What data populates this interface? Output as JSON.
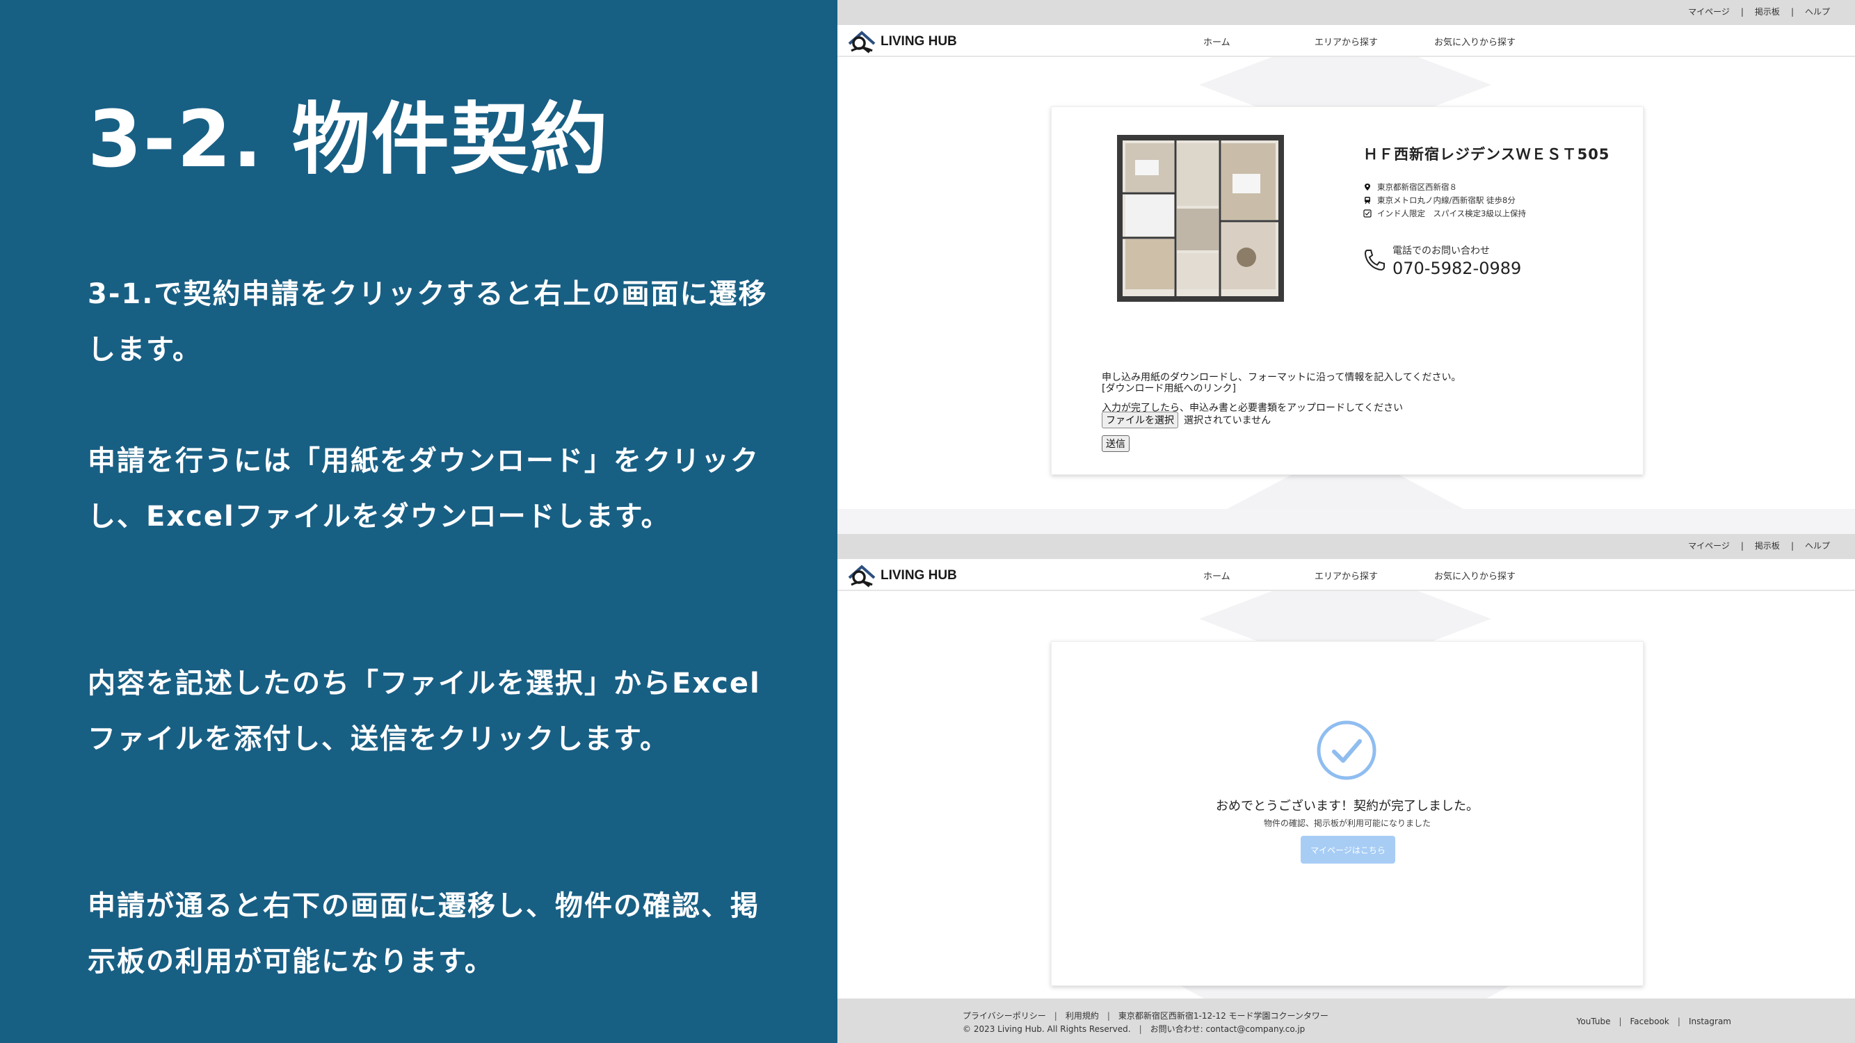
{
  "slide": {
    "title": "3-2. 物件契約",
    "paragraphs": [
      "3-1.で契約申請をクリックすると右上の画面に遷移します。",
      "申請を行うには「用紙をダウンロード」をクリックし、Excelファイルをダウンロードします。",
      "内容を記述したのち「ファイルを選択」からExcelファイルを添付し、送信をクリックします。",
      "申請が通ると右下の画面に遷移し、物件の確認、掲示板の利用が可能になります。"
    ]
  },
  "site": {
    "logo_text": "LIVING HUB",
    "top_links": [
      "マイページ",
      "|",
      "掲示板",
      "|",
      "ヘルプ"
    ],
    "nav": {
      "home": "ホーム",
      "area": "エリアから探す",
      "favorites": "お気に入りから探す"
    }
  },
  "contract_page": {
    "property_name": "ＨＦ西新宿レジデンスＷＥＳＴ505",
    "address": "東京都新宿区西新宿８",
    "station": "東京メトロ丸ノ内線/西新宿駅 徒歩8分",
    "conditions": "インド人限定　スパイス検定3級以上保持",
    "phone_label": "電話でのお問い合わせ",
    "phone_number": "070-5982-0989",
    "instruction": "申し込み用紙のダウンロードし、フォーマットに沿って情報を記入してください。",
    "download_link": "[ダウンロード用紙へのリンク]",
    "upload_instruction": "入力が完了したら、申込み書と必要書類をアップロードしてください",
    "file_button": "ファイルを選択",
    "file_status": "選択されていません",
    "submit_button": "送信"
  },
  "complete_page": {
    "message": "おめでとうございます！契約が完了しました。",
    "sub_message": "物件の確認、掲示板が利用可能になりました",
    "mypage_button": "マイページはこちら"
  },
  "footer": {
    "privacy": "プライバシーポリシー",
    "terms": "利用規約",
    "address": "東京都新宿区西新宿1-12-12 モード学園コクーンタワー",
    "copyright": "© 2023 Living Hub. All Rights Reserved.",
    "contact": "お問い合わせ: contact@company.co.jp",
    "social": [
      "YouTube",
      "Facebook",
      "Instagram"
    ]
  },
  "colors": {
    "left_panel": "#185f84",
    "topbar": "#dcdcdc",
    "mypage_button": "#a7cdf5",
    "check": "#8fbdf0"
  },
  "icons": [
    "location-pin-icon",
    "train-icon",
    "checkbox-icon",
    "phone-icon",
    "check-circle-icon",
    "living-hub-logo"
  ]
}
